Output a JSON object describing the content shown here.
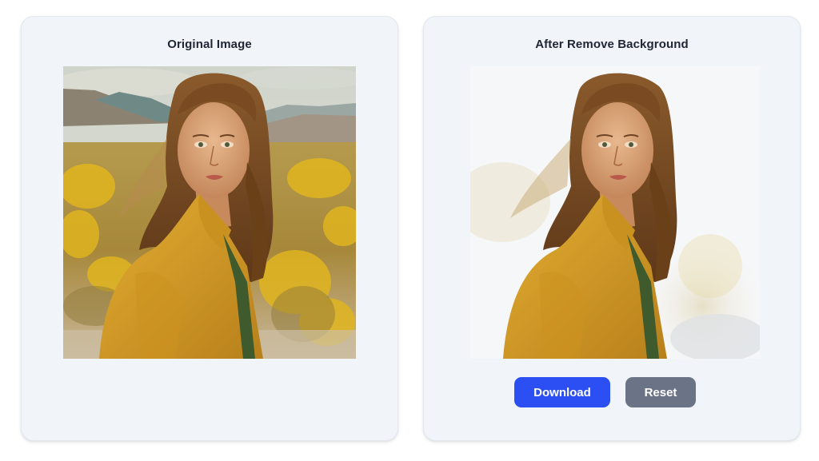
{
  "original_panel": {
    "title": "Original Image",
    "image_alt": "Woman in yellow jacket in a desert field with yellow flowers"
  },
  "result_panel": {
    "title": "After Remove Background",
    "image_alt": "Woman in yellow jacket with background removed",
    "download_label": "Download",
    "reset_label": "Reset"
  },
  "colors": {
    "panel_bg": "#f1f4f9",
    "primary_button": "#2b4ff2",
    "secondary_button": "#6b7486",
    "jacket": "#d9a22a",
    "hair": "#7a4a22"
  }
}
